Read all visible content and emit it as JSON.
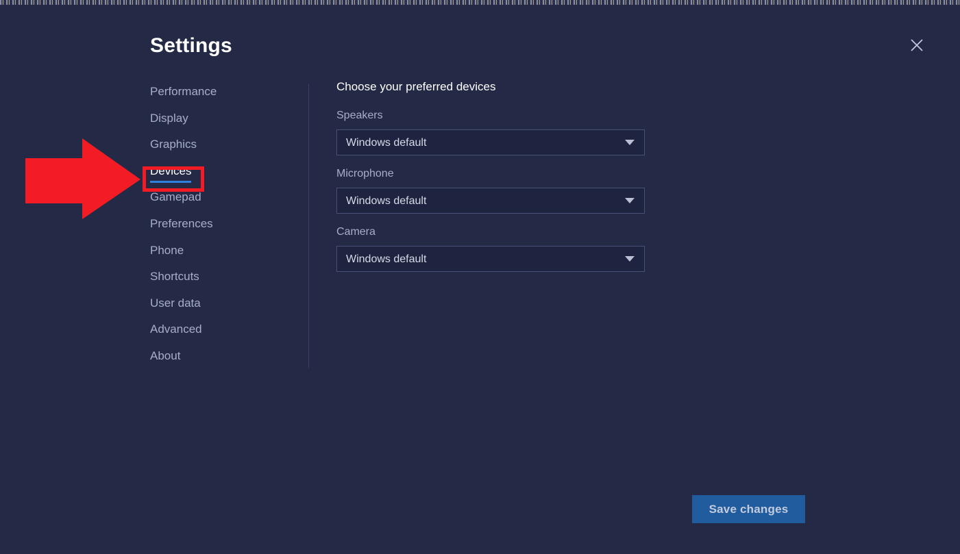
{
  "window": {
    "title": "Settings",
    "close_icon": "close-icon"
  },
  "sidebar": {
    "items": [
      {
        "label": "Performance",
        "active": false
      },
      {
        "label": "Display",
        "active": false
      },
      {
        "label": "Graphics",
        "active": false
      },
      {
        "label": "Devices",
        "active": true
      },
      {
        "label": "Gamepad",
        "active": false
      },
      {
        "label": "Preferences",
        "active": false
      },
      {
        "label": "Phone",
        "active": false
      },
      {
        "label": "Shortcuts",
        "active": false
      },
      {
        "label": "User data",
        "active": false
      },
      {
        "label": "Advanced",
        "active": false
      },
      {
        "label": "About",
        "active": false
      }
    ]
  },
  "content": {
    "heading": "Choose your preferred devices",
    "fields": [
      {
        "label": "Speakers",
        "value": "Windows default",
        "caret_icon": "chevron-down-icon"
      },
      {
        "label": "Microphone",
        "value": "Windows default",
        "caret_icon": "chevron-down-icon"
      },
      {
        "label": "Camera",
        "value": "Windows default",
        "caret_icon": "chevron-down-icon"
      }
    ]
  },
  "footer": {
    "save_label": "Save changes"
  },
  "annotation": {
    "color": "#f41c24",
    "target": "Devices",
    "arrow_icon": "right-arrow-annotation-icon",
    "box_icon": "highlight-box-annotation-icon"
  },
  "theme": {
    "background": "#242a45",
    "accent_blue": "#2f80e0",
    "button_blue": "#215c9e",
    "text_primary": "#ffffff",
    "text_muted": "#a8aec6",
    "field_fill": "#1e2340",
    "field_border": "#4b5176",
    "divider": "#3a4063"
  }
}
